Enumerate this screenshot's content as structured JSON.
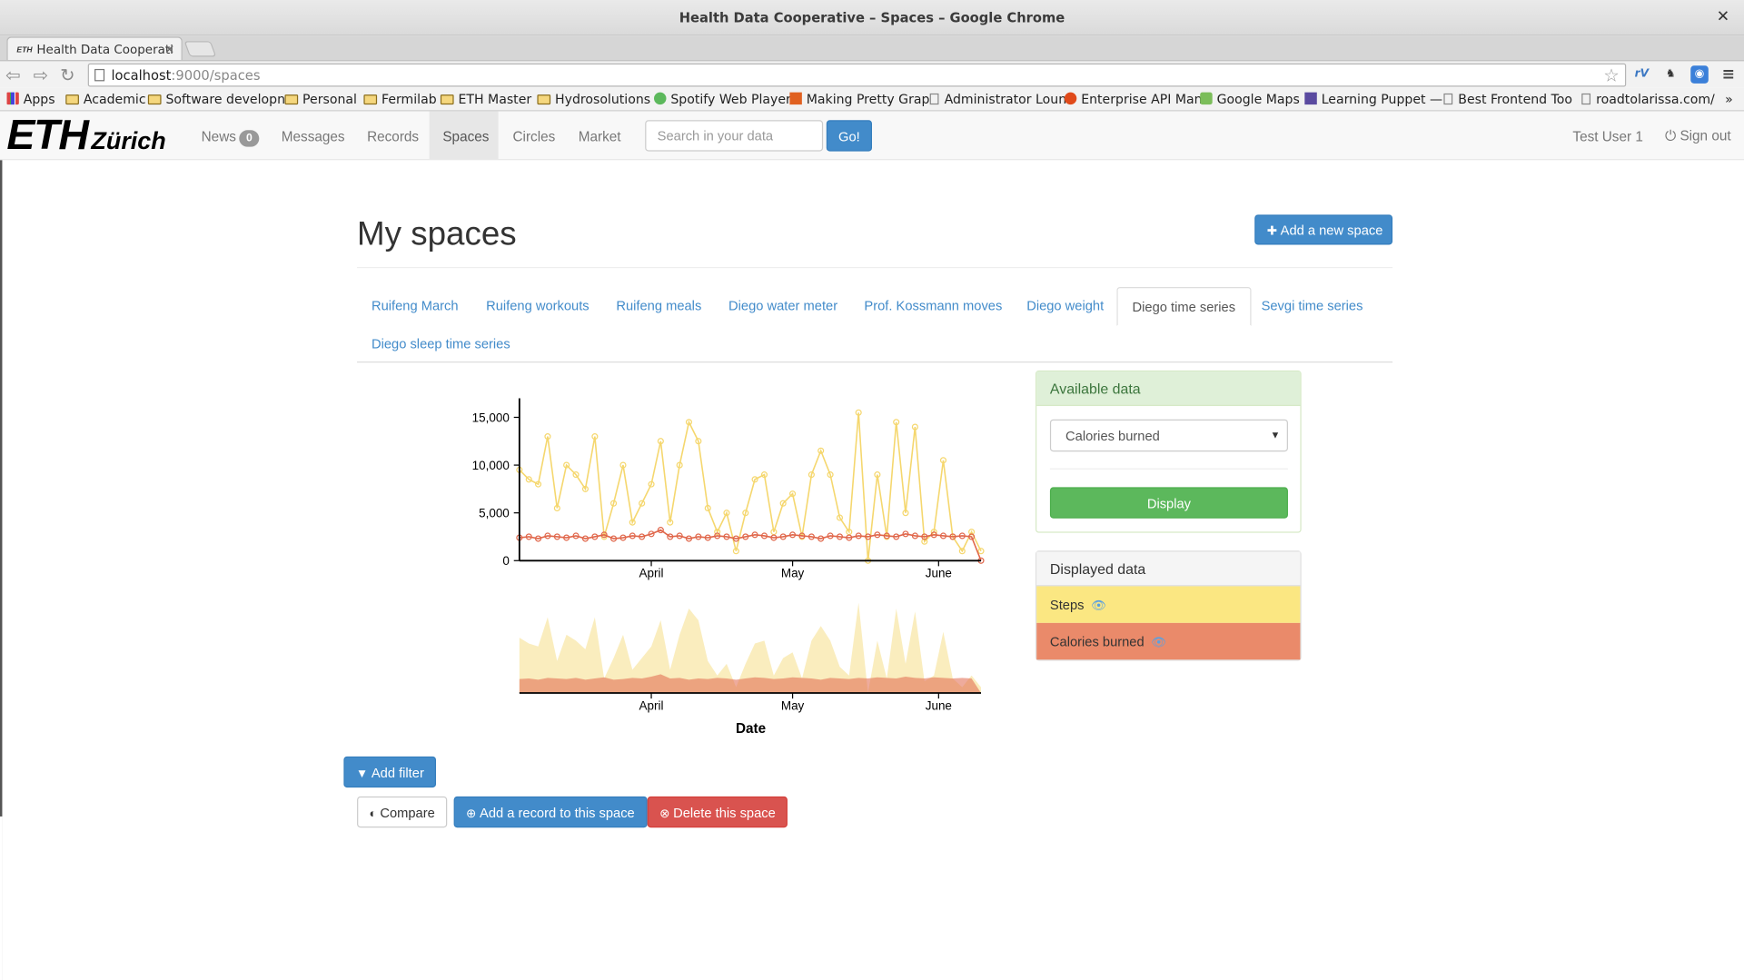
{
  "window": {
    "title": "Health Data Cooperative – Spaces – Google Chrome"
  },
  "browser": {
    "tab_title": "Health Data Cooperati",
    "favicon_text": "ETH",
    "url_host": "localhost",
    "url_rest": ":9000/spaces",
    "bookmarks": [
      "Apps",
      "Academic",
      "Software developn",
      "Personal",
      "Fermilab",
      "ETH Master",
      "Hydrosolutions",
      "Spotify Web Player",
      "Making Pretty Grap",
      "Administrator Loun",
      "Enterprise API Man",
      "Google Maps",
      "Learning Puppet —",
      "Best Frontend Too",
      "roadtolarissa.com/"
    ]
  },
  "appnav": {
    "logo_main": "ETH",
    "logo_sub": "Zürich",
    "items": [
      {
        "label": "News",
        "badge": "0"
      },
      {
        "label": "Messages"
      },
      {
        "label": "Records"
      },
      {
        "label": "Spaces"
      },
      {
        "label": "Circles"
      },
      {
        "label": "Market"
      }
    ],
    "search_placeholder": "Search in your data",
    "go_label": "Go!",
    "user": "Test User 1",
    "signout": "Sign out"
  },
  "page": {
    "title": "My spaces",
    "add_space_label": "Add a new space",
    "space_tabs": [
      "Ruifeng March",
      "Ruifeng workouts",
      "Ruifeng meals",
      "Diego water meter",
      "Prof. Kossmann moves",
      "Diego weight",
      "Diego time series",
      "Sevgi time series",
      "Diego sleep time series"
    ],
    "active_tab": "Diego time series"
  },
  "available_panel": {
    "heading": "Available data",
    "selected_option": "Calories burned",
    "display_label": "Display"
  },
  "displayed_panel": {
    "heading": "Displayed data",
    "items": [
      {
        "label": "Steps",
        "color": "#fbe782"
      },
      {
        "label": "Calories burned",
        "color": "#ea8a6a"
      }
    ]
  },
  "buttons": {
    "add_filter": "Add filter",
    "compare": "Compare",
    "add_record": "Add a record to this space",
    "delete_space": "Delete this space"
  },
  "chart_data": {
    "type": "line",
    "x_type": "date",
    "x": [
      "2014-03-04",
      "2014-03-06",
      "2014-03-08",
      "2014-03-10",
      "2014-03-12",
      "2014-03-14",
      "2014-03-16",
      "2014-03-18",
      "2014-03-20",
      "2014-03-22",
      "2014-03-24",
      "2014-03-26",
      "2014-03-28",
      "2014-03-30",
      "2014-04-01",
      "2014-04-03",
      "2014-04-05",
      "2014-04-07",
      "2014-04-09",
      "2014-04-11",
      "2014-04-13",
      "2014-04-15",
      "2014-04-17",
      "2014-04-19",
      "2014-04-21",
      "2014-04-23",
      "2014-04-25",
      "2014-04-27",
      "2014-04-29",
      "2014-05-01",
      "2014-05-03",
      "2014-05-05",
      "2014-05-07",
      "2014-05-09",
      "2014-05-11",
      "2014-05-13",
      "2014-05-15",
      "2014-05-17",
      "2014-05-19",
      "2014-05-21",
      "2014-05-23",
      "2014-05-25",
      "2014-05-27",
      "2014-05-29",
      "2014-05-31",
      "2014-06-02",
      "2014-06-04",
      "2014-06-06",
      "2014-06-08",
      "2014-06-10"
    ],
    "series": [
      {
        "name": "Steps",
        "color": "#f5d76e",
        "values": [
          9500,
          8500,
          8000,
          13000,
          5500,
          10000,
          9000,
          7500,
          13000,
          2500,
          6000,
          10000,
          4000,
          6000,
          8000,
          12500,
          4000,
          10000,
          14500,
          12500,
          5500,
          3000,
          5000,
          1000,
          5000,
          8500,
          9000,
          3000,
          6000,
          7000,
          2500,
          9000,
          11500,
          9000,
          4500,
          3000,
          15500,
          0,
          9000,
          2500,
          14500,
          5000,
          14000,
          2000,
          3000,
          10500,
          2500,
          1000,
          3000,
          1000
        ]
      },
      {
        "name": "Calories burned",
        "color": "#e0664a",
        "values": [
          2400,
          2500,
          2300,
          2600,
          2500,
          2400,
          2600,
          2300,
          2500,
          2700,
          2300,
          2400,
          2600,
          2500,
          2800,
          3200,
          2500,
          2600,
          2300,
          2500,
          2400,
          2600,
          2500,
          2300,
          2500,
          2700,
          2600,
          2400,
          2500,
          2700,
          2600,
          2500,
          2300,
          2600,
          2500,
          2400,
          2600,
          2500,
          2700,
          2600,
          2500,
          2800,
          2600,
          2500,
          2700,
          2600,
          2500,
          2600,
          2500,
          0
        ]
      }
    ],
    "ylim": [
      0,
      17000
    ],
    "yticks": [
      "0",
      "5,000",
      "10,000",
      "15,000"
    ],
    "xticks": [
      "April",
      "May",
      "June"
    ],
    "xlabel": "Date",
    "ylabel": ""
  }
}
